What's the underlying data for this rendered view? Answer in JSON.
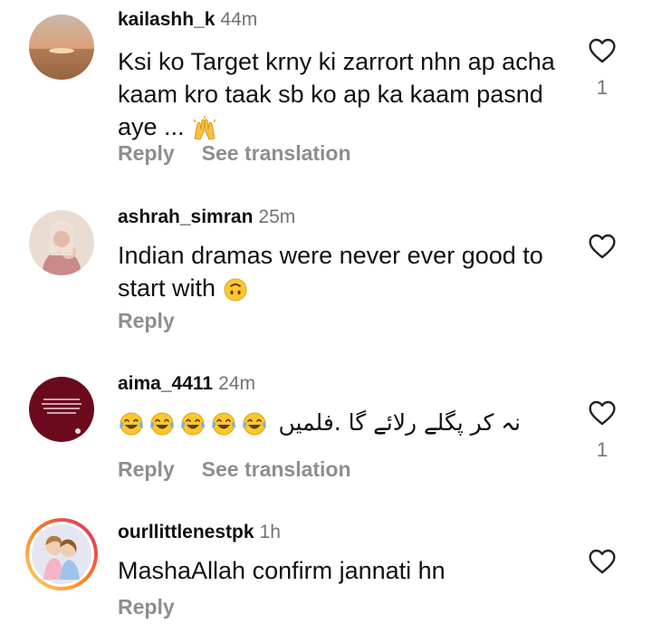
{
  "comments": [
    {
      "username": "kailashh_k",
      "time": "44m",
      "text": "Ksi ko Target krny ki zarrort nhn ap acha kaam kro taak sb ko ap ka kaam pasnd aye ...",
      "emoji": "raising-hands",
      "reply_label": "Reply",
      "translate_label": "See translation",
      "likes": "1"
    },
    {
      "username": "ashrah_simran",
      "time": "25m",
      "text": "Indian dramas were never ever good to start with",
      "emoji": "upside-down-face",
      "reply_label": "Reply",
      "likes": ""
    },
    {
      "username": "aima_4411",
      "time": "24m",
      "text": "نہ کر پگلے رلائے گا .فلمیں",
      "emoji": "tears-of-joy x5",
      "reply_label": "Reply",
      "translate_label": "See translation",
      "likes": "1"
    },
    {
      "username": "ourllittlenestpk",
      "time": "1h",
      "text": "MashaAllah confirm jannati hn",
      "reply_label": "Reply",
      "likes": ""
    }
  ],
  "colors": {
    "text": "#111111",
    "muted": "#8e8e8e",
    "story_ring_start": "#feda75",
    "story_ring_end": "#d62976"
  }
}
